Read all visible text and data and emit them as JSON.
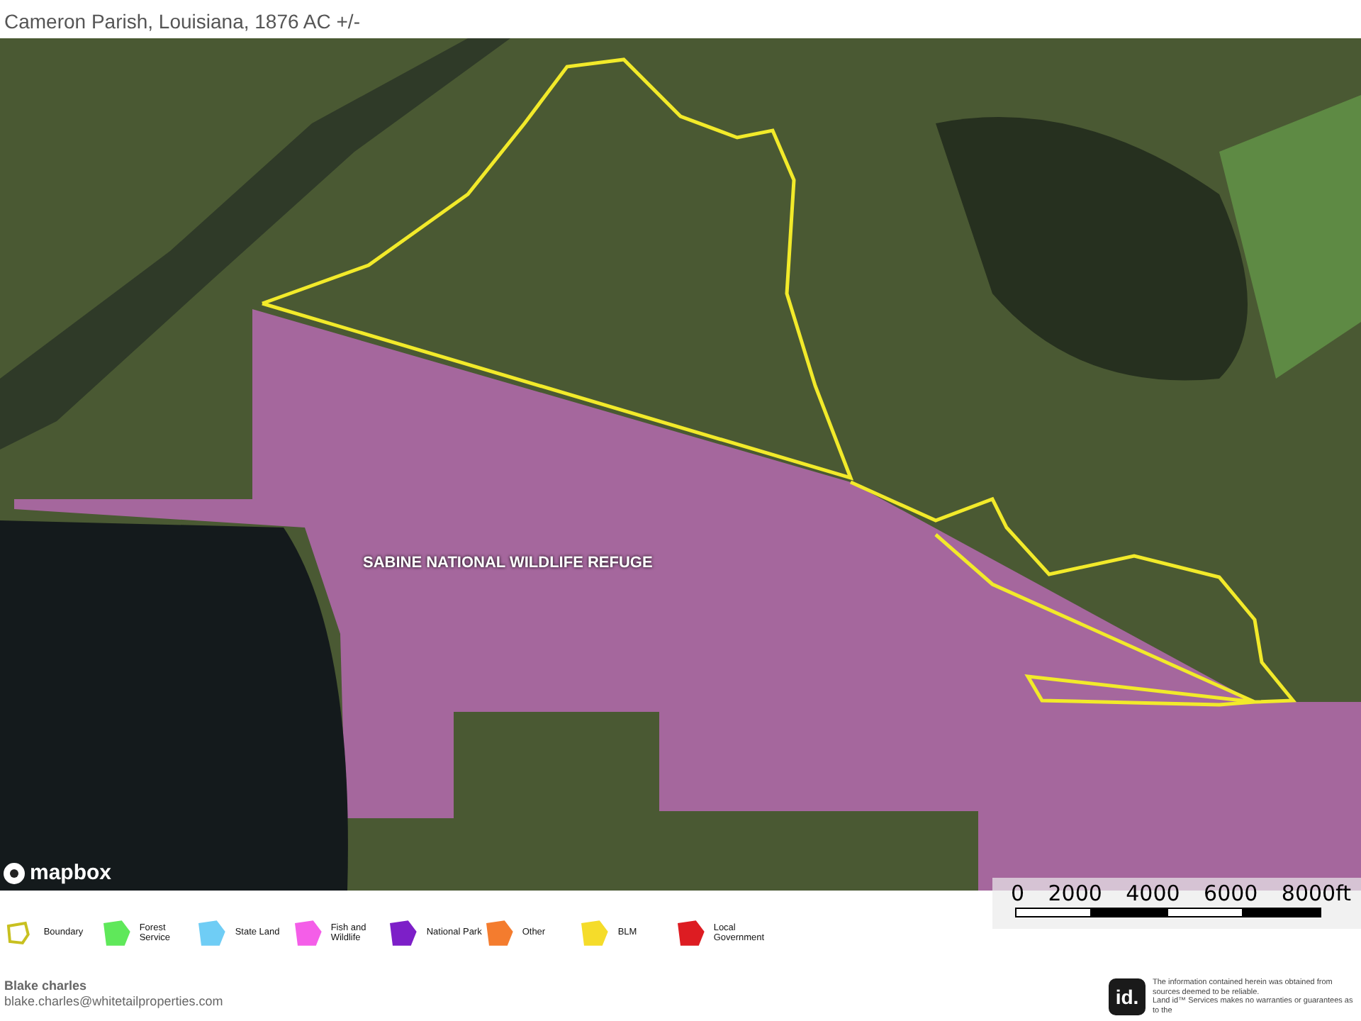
{
  "header": {
    "subtitle": "Cameron Parish, Louisiana, 1876 AC +/-"
  },
  "map": {
    "refuge_label": "SABINE NATIONAL WILDLIFE REFUGE",
    "attribution": "mapbox",
    "scale_labels": [
      "0",
      "2000",
      "4000",
      "6000",
      "8000ft"
    ]
  },
  "legend": [
    {
      "label": "Boundary",
      "kind": "outline",
      "color": "#c8c020"
    },
    {
      "label": "Forest Service",
      "kind": "fill",
      "color": "#5fe85a"
    },
    {
      "label": "State Land",
      "kind": "fill",
      "color": "#6fcdf5"
    },
    {
      "label": "Fish and Wildlife",
      "kind": "fill",
      "color": "#f45ee8"
    },
    {
      "label": "National Park",
      "kind": "fill",
      "color": "#7d1fc8"
    },
    {
      "label": "Other",
      "kind": "fill",
      "color": "#f47c2e"
    },
    {
      "label": "BLM",
      "kind": "fill",
      "color": "#f5dc2a"
    },
    {
      "label": "Local Government",
      "kind": "fill",
      "color": "#dd1c22"
    }
  ],
  "footer": {
    "agent_name": "Blake charles",
    "agent_email": "blake.charles@whitetailproperties.com",
    "logo_text": "id.",
    "disclaimer": [
      "The information contained herein was obtained from sources deemed to be reliable.",
      "Land id™ Services makes no warranties or guarantees as to the"
    ]
  }
}
